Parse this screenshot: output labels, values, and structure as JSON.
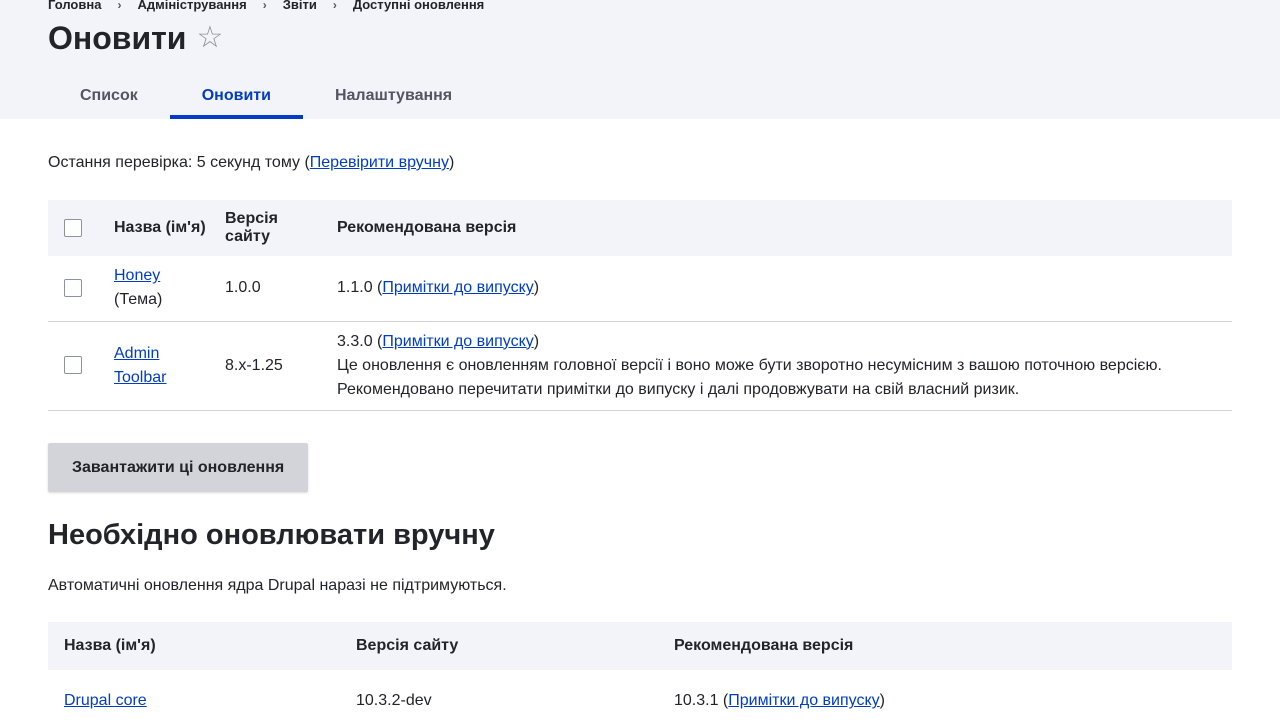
{
  "breadcrumb": [
    {
      "label": "Головна"
    },
    {
      "label": "Адміністрування"
    },
    {
      "label": "Звіти"
    },
    {
      "label": "Доступні оновлення"
    }
  ],
  "breadcrumb_separator": "›",
  "page_title": "Оновити",
  "favorite_icon": "☆",
  "tabs": [
    {
      "label": "Список",
      "active": false
    },
    {
      "label": "Оновити",
      "active": true
    },
    {
      "label": "Налаштування",
      "active": false
    }
  ],
  "last_check": {
    "text": "Остання перевірка: 5 секунд тому (",
    "link": "Перевірити вручну",
    "close": ")"
  },
  "updates_table": {
    "headers": {
      "name": "Назва (ім'я)",
      "site_version": "Версія сайту",
      "recommended": "Рекомендована версія"
    },
    "rows": [
      {
        "name_link": "Honey",
        "type": "(Тема)",
        "site_version": "1.0.0",
        "rec_version": "1.1.0 (",
        "release_notes": "Примітки до випуску",
        "close": ")",
        "warning": ""
      },
      {
        "name_link": "Admin Toolbar",
        "type": "",
        "site_version": "8.x-1.25",
        "rec_version": "3.3.0 (",
        "release_notes": "Примітки до випуску",
        "close": ")",
        "warning": "Це оновлення є оновленням головної версії і воно може бути зворотно несумісним з вашою поточною версією. Рекомендовано перечитати примітки до випуску і далі продовжувати на свій власний ризик."
      }
    ]
  },
  "download_button": "Завантажити ці оновлення",
  "manual_section": {
    "title": "Необхідно оновлювати вручну",
    "description": "Автоматичні оновлення ядра Drupal наразі не підтримуються.",
    "headers": {
      "name": "Назва (ім'я)",
      "site_version": "Версія сайту",
      "recommended": "Рекомендована версія"
    },
    "rows": [
      {
        "name_link": "Drupal core",
        "site_version": "10.3.2-dev",
        "rec_version": "10.3.1 (",
        "release_notes": "Примітки до випуску",
        "close": ")"
      }
    ]
  },
  "colors": {
    "link": "#003cc5",
    "header_bg": "#f3f4f9",
    "button_bg": "#d3d4d9"
  }
}
